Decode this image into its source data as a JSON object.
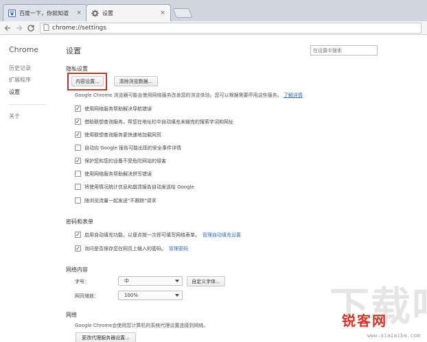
{
  "tabs": [
    {
      "title": "百度一下，你就知道",
      "icon": "baidu-paw-icon",
      "close": "×"
    },
    {
      "title": "设置",
      "icon": "gear-icon",
      "close": "×"
    }
  ],
  "toolbar": {
    "url": "chrome://settings"
  },
  "sidebar": {
    "brand": "Chrome",
    "items": [
      "历史记录",
      "扩展程序",
      "设置"
    ],
    "about": "关于"
  },
  "main": {
    "title": "设置",
    "search_placeholder": "在设置中搜索",
    "privacy": {
      "heading": "隐私设置",
      "content_settings_button": "内容设置...",
      "clear_data_button": "清除浏览数据...",
      "description": "Google Chrome 浏览器可能会使用网络服务改善您的浏览体验。您可以根据需要停用这些服务。",
      "learn_more": "了解详情",
      "options": [
        {
          "label": "使用网络服务帮助解决导航错误",
          "checked": true
        },
        {
          "label": "借助联想查询服务，帮您在地址栏中自动填充未输完的搜索字词和网址",
          "checked": true
        },
        {
          "label": "使用联想查询服务更快速地加载网页",
          "checked": true
        },
        {
          "label": "自动向 Google 报告可能出现的安全事件详情",
          "checked": false
        },
        {
          "label": "保护您和您的设备不受危险网站的侵害",
          "checked": true
        },
        {
          "label": "使用网络服务帮助解决拼写错误",
          "checked": false
        },
        {
          "label": "将使用情况统计信息和崩溃报告自动发送给 Google",
          "checked": false
        },
        {
          "label": "随浏览流量一起发送\"不跟踪\"请求",
          "checked": false
        }
      ]
    },
    "passwords": {
      "heading": "密码和表单",
      "autofill_label": "启用自动填充功能，以便点按一次即可填写网络表单。",
      "autofill_link": "管理自动填充设置",
      "autofill_checked": true,
      "save_label": "询问是否保存您在网页上输入的密码。",
      "save_link": "管理密码",
      "save_checked": true
    },
    "web_content": {
      "heading": "网络内容",
      "font_size_label": "字号：",
      "font_size_value": "中",
      "custom_fonts_button": "自定义字体...",
      "zoom_label": "网页缩放：",
      "zoom_value": "100%"
    },
    "network": {
      "heading": "网络",
      "description": "Google Chrome会使用您计算机的系统代理设置连接到网络。",
      "proxy_button": "更改代理服务器设置..."
    }
  },
  "watermark": {
    "large": "下载吧",
    "brand": "锐客网",
    "url": "www.xiazaiba.com"
  },
  "colors": {
    "highlight_box": "#c9302c",
    "link": "#3366bb",
    "tabstrip": "#cfd6e0"
  }
}
